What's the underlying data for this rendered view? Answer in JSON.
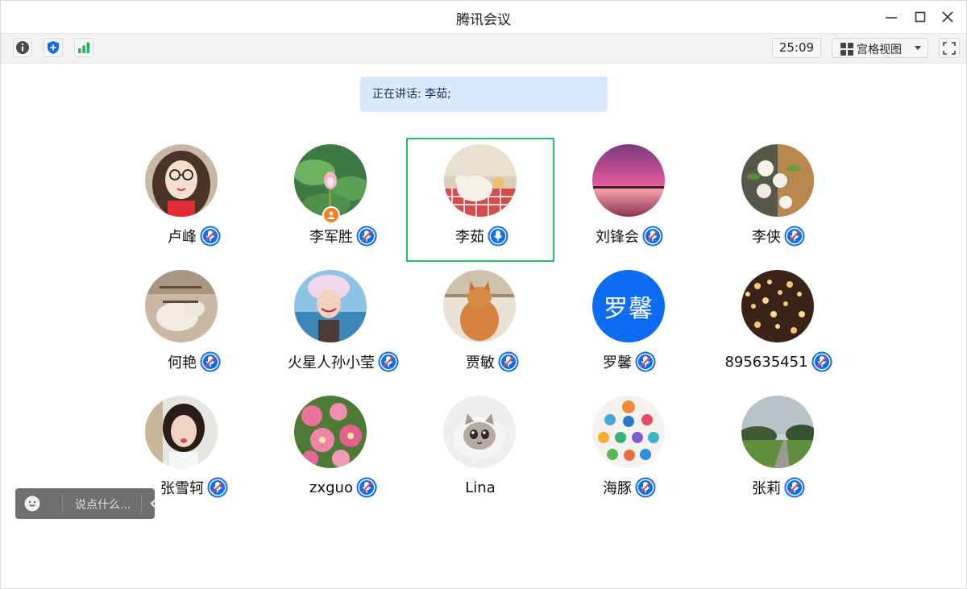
{
  "window": {
    "title": "腾讯会议"
  },
  "toolbar": {
    "timer": "25:09",
    "view_label": "宫格视图",
    "icons": [
      "info-icon",
      "shield-plus-icon",
      "signal-bars-icon",
      "grid-view-icon",
      "fullscreen-icon"
    ]
  },
  "speaking": {
    "text": "正在讲话: 李茹;"
  },
  "participants": [
    {
      "name": "卢峰",
      "mic": "muted"
    },
    {
      "name": "李军胜",
      "mic": "muted",
      "host": true
    },
    {
      "name": "李茹",
      "mic": "active",
      "speaking": true
    },
    {
      "name": "刘锋会",
      "mic": "muted"
    },
    {
      "name": "李侠",
      "mic": "muted"
    },
    {
      "name": "何艳",
      "mic": "muted"
    },
    {
      "name": "火星人孙小莹",
      "mic": "muted"
    },
    {
      "name": "贾敏",
      "mic": "muted"
    },
    {
      "name": "罗馨",
      "mic": "muted",
      "avatar_text": "罗馨"
    },
    {
      "name": "895635451",
      "mic": "muted"
    },
    {
      "name": "张雪轲",
      "mic": "muted"
    },
    {
      "name": "zxguo",
      "mic": "muted"
    },
    {
      "name": "Lina",
      "mic": "none"
    },
    {
      "name": "海豚",
      "mic": "muted"
    },
    {
      "name": "张莉",
      "mic": "muted"
    }
  ],
  "chat": {
    "placeholder": "说点什么..."
  },
  "colors": {
    "accent": "#0d6cf2",
    "speaking_border": "#1fc16b",
    "banner_bg": "#d9e9ff",
    "mute_slash": "#e24a4a",
    "host_badge": "#f47f23"
  }
}
